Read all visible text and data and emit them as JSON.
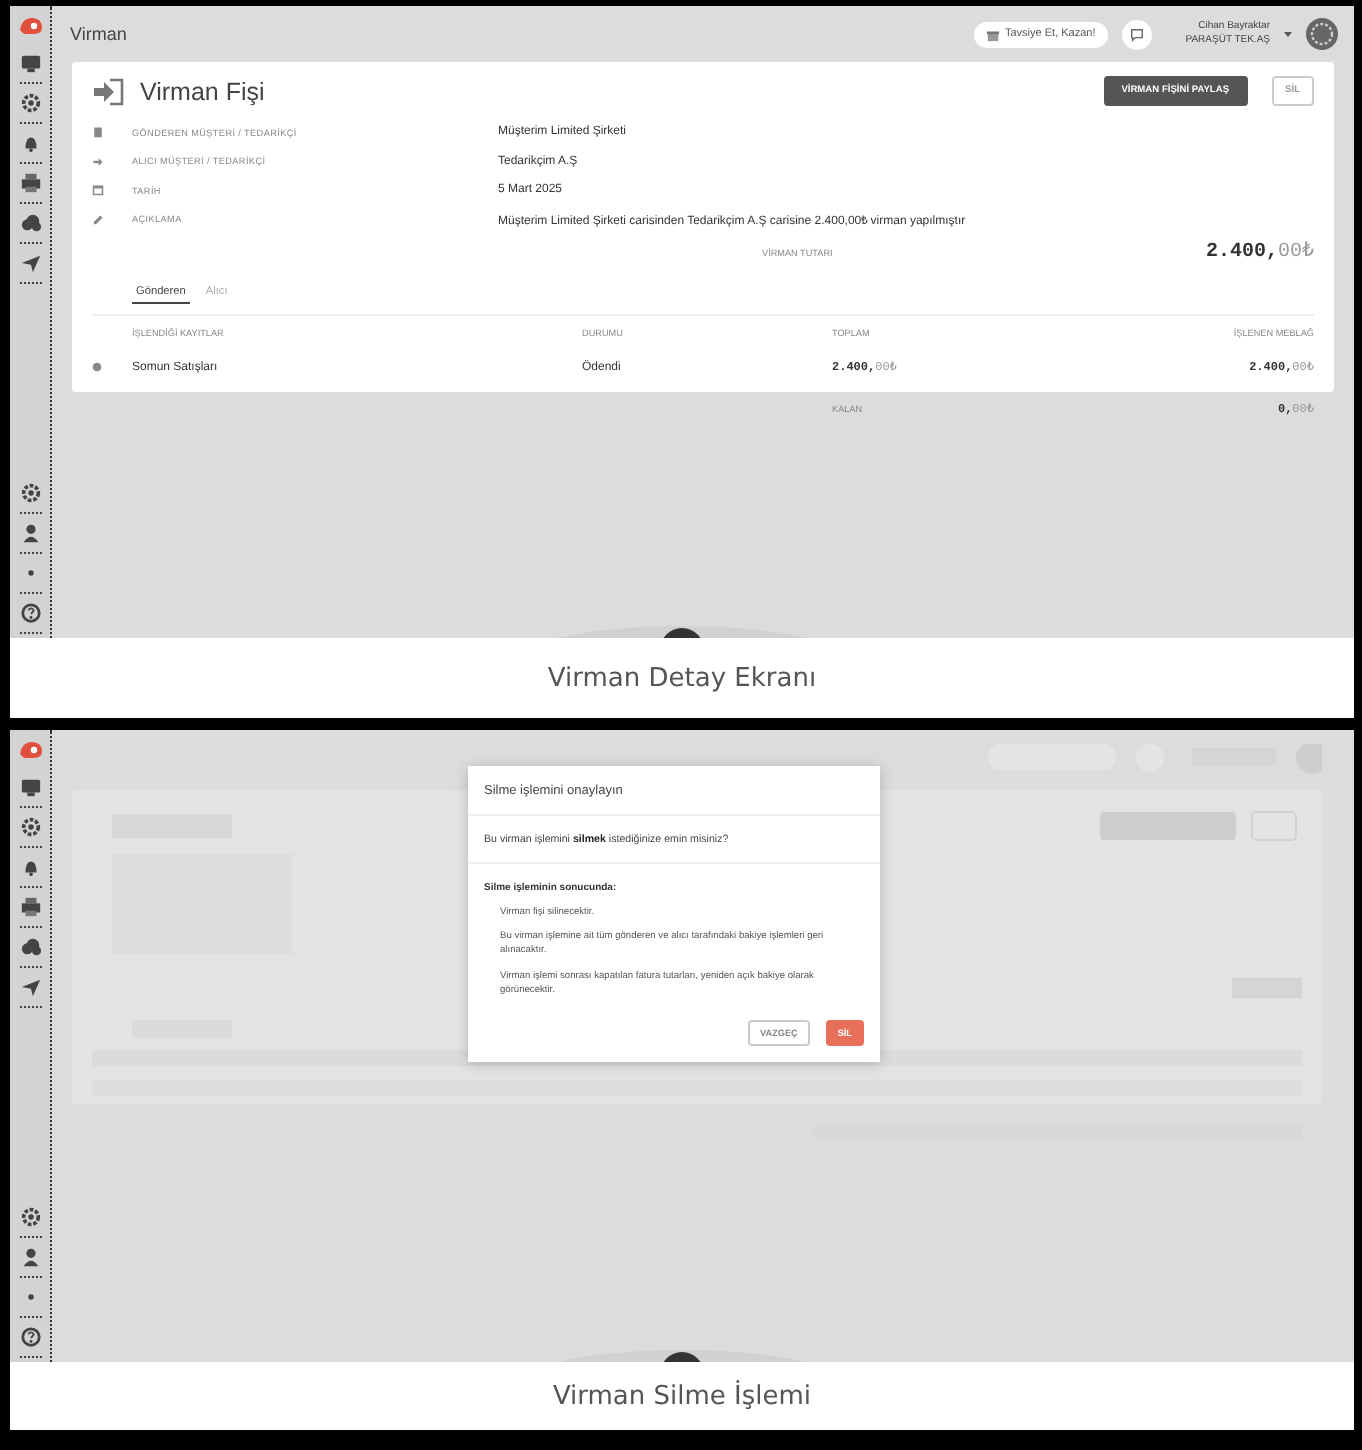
{
  "panels": [
    {
      "caption": "Virman Detay Ekranı",
      "screen": {
        "page_title": "Virman",
        "invite_button": "Tavsiye Et, Kazan!",
        "user": {
          "name": "Cihan Bayraktar",
          "company": "PARAŞÜT TEK.AŞ"
        },
        "voucher": {
          "title": "Virman Fişi",
          "share_button": "VİRMAN FİŞİNİ PAYLAŞ",
          "delete_button": "SİL",
          "details": [
            {
              "kind": "sender",
              "label": "GÖNDEREN MÜŞTERİ / TEDARİKÇİ",
              "value": "Müşterim Limited Şirketi"
            },
            {
              "kind": "receiver",
              "label": "ALICI MÜŞTERİ / TEDARİKÇİ",
              "value": "Tedarikçim A.Ş"
            },
            {
              "kind": "date",
              "label": "TARİH",
              "value": "5 Mart 2025"
            },
            {
              "kind": "note",
              "label": "AÇIKLAMA",
              "value": "Müşterim Limited Şirketi carisinden Tedarikçim A.Ş carisine 2.400,00₺ virman yapılmıştır"
            }
          ],
          "total_label": "VİRMAN TUTARI",
          "total": "**2.400,**00₺",
          "tabs": [
            {
              "label": "Gönderen",
              "selected": true
            },
            {
              "label": "Alıcı",
              "selected": false
            }
          ],
          "columns": [
            "İŞLENDİĞİ KAYITLAR",
            "DURUMU",
            "TOPLAM",
            "İŞLENEN MEBLAĞ"
          ],
          "rows": [
            {
              "cells": [
                "Somun Satışları",
                "Ödendi",
                "**2.400,**00₺",
                "**2.400,**00₺"
              ]
            }
          ],
          "remaining_label": "KALAN",
          "remaining": "**0,**00₺"
        }
      }
    },
    {
      "caption": "Virman Silme İşlemi",
      "screen": {
        "dialog": {
          "title": "Silme işlemini onaylayın",
          "question": "Bu virman işlemini **silmek** istediğinize emin misiniz?",
          "consequences_title": "Silme işleminin sonucunda:",
          "consequences": [
            "Virman fişi silinecektir.",
            "Bu virman işlemine ait tüm gönderen ve alıcı tarafındaki bakiye işlemleri geri alınacaktır.",
            "Virman işlemi sonrası kapatılan fatura tutarları, yeniden açık bakiye olarak görünecektir."
          ],
          "cancel_button": "VAZGEÇ",
          "confirm_button": "SİL"
        }
      }
    }
  ]
}
